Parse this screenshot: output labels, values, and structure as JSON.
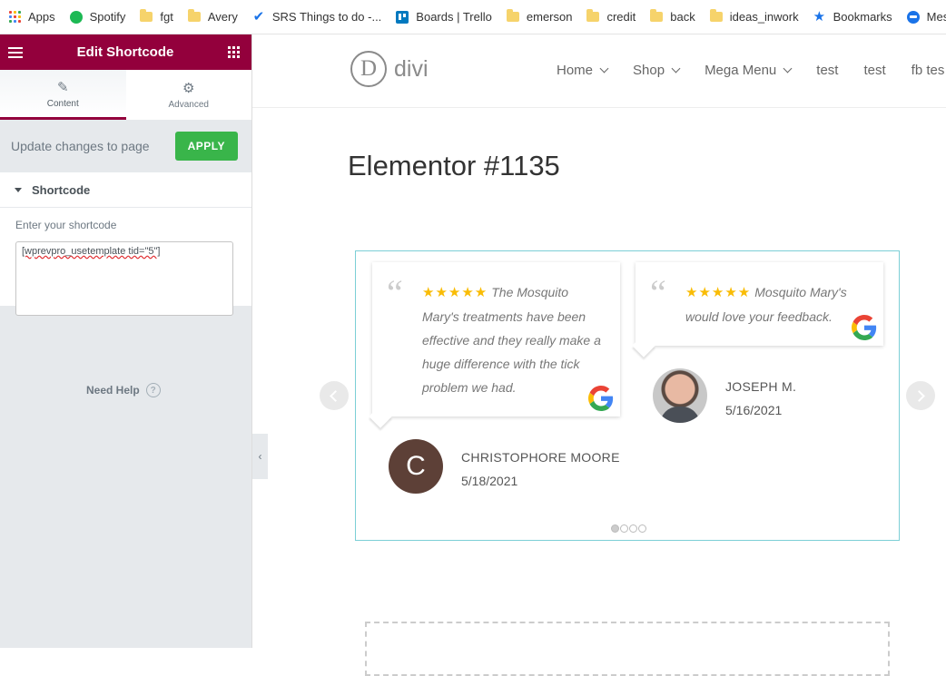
{
  "bookmarks": [
    {
      "label": "Apps",
      "icon": "apps-grid-icon"
    },
    {
      "label": "Spotify",
      "icon": "spotify-icon"
    },
    {
      "label": "fgt",
      "icon": "folder-icon"
    },
    {
      "label": "Avery",
      "icon": "folder-icon"
    },
    {
      "label": "SRS Things to do -...",
      "icon": "checkmark-icon"
    },
    {
      "label": "Boards | Trello",
      "icon": "trello-icon"
    },
    {
      "label": "emerson",
      "icon": "folder-icon"
    },
    {
      "label": "credit",
      "icon": "folder-icon"
    },
    {
      "label": "back",
      "icon": "folder-icon"
    },
    {
      "label": "ideas_inwork",
      "icon": "folder-icon"
    },
    {
      "label": "Bookmarks",
      "icon": "star-icon"
    },
    {
      "label": "Message",
      "icon": "messages-icon"
    }
  ],
  "panel": {
    "title": "Edit Shortcode",
    "tabs": [
      {
        "label": "Content",
        "icon": "pencil-icon"
      },
      {
        "label": "Advanced",
        "icon": "gear-icon"
      }
    ],
    "update_text": "Update changes to page",
    "apply_label": "APPLY",
    "section_title": "Shortcode",
    "field_label": "Enter your shortcode",
    "shortcode_value": "[wprevpro_usetemplate tid=\"5\"]",
    "need_help": "Need Help",
    "help_glyph": "?",
    "collapse_glyph": "‹"
  },
  "site": {
    "logo_letter": "D",
    "logo_text": "divi",
    "nav": [
      {
        "label": "Home",
        "dropdown": true
      },
      {
        "label": "Shop",
        "dropdown": true
      },
      {
        "label": "Mega Menu",
        "dropdown": true
      },
      {
        "label": "test",
        "dropdown": false
      },
      {
        "label": "test",
        "dropdown": false
      },
      {
        "label": "fb tes",
        "dropdown": false
      }
    ],
    "page_title": "Elementor #1135"
  },
  "reviews": [
    {
      "quote": "“",
      "stars": "★★★★★",
      "text": "The Mosquito Mary's treatments have been effective and they really make a huge difference with the tick problem we had.",
      "name": "CHRISTOPHORE MOORE",
      "date": "5/18/2021",
      "avatar_letter": "C"
    },
    {
      "quote": "“",
      "stars": "★★★★★",
      "text": "Mosquito Mary's would love your feedback.",
      "name": "JOSEPH M.",
      "date": "5/16/2021"
    }
  ],
  "colors": {
    "elementor_brand": "#93003c",
    "apply_green": "#39b54a",
    "star_gold": "#f9bc05",
    "slider_border": "#7ccfd6"
  },
  "slider": {
    "page_count": 4,
    "active_page": 1
  }
}
